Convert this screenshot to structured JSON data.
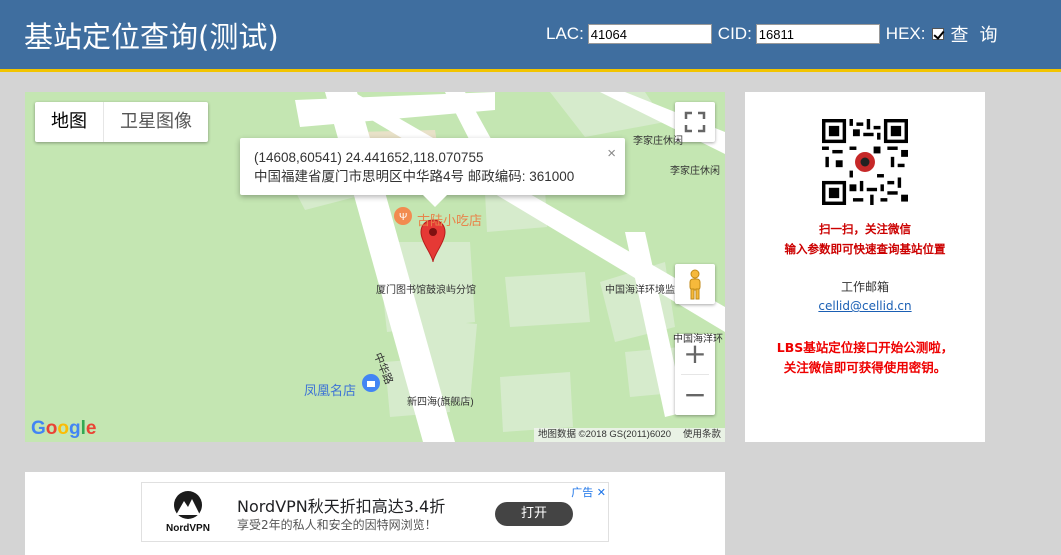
{
  "header": {
    "title": "基站定位查询(测试)",
    "lac_label": "LAC:",
    "lac_value": "41064",
    "cid_label": "CID:",
    "cid_value": "16811",
    "hex_label": "HEX:",
    "hex_checked": true,
    "query_label": "查 询"
  },
  "map": {
    "type_buttons": [
      "地图",
      "卫星图像"
    ],
    "info": {
      "line1": "(14608,60541)  24.441652,118.070755",
      "line2": "中国福建省厦门市思明区中华路4号 邮政编码: 361000",
      "close": "×"
    },
    "labels": {
      "l1": "李家庄休闲",
      "l2": "李家庄休闲",
      "l3": "古陆小吃店",
      "l4": "厦门图书馆鼓浪屿分馆",
      "l5": "中国海洋环境监",
      "l6": "中华路",
      "l7": "凤凰名店",
      "l8": "新四海(旗舰店)",
      "l9": "中国海洋环"
    },
    "zoom_in": "+",
    "zoom_out": "−",
    "attribution": "地图数据 ©2018 GS(2011)6020",
    "terms": "使用条款",
    "google": [
      "G",
      "o",
      "o",
      "g",
      "l",
      "e"
    ]
  },
  "side": {
    "scan_line1": "扫一扫，关注微信",
    "scan_line2": "输入参数即可快速查询基站位置",
    "mail_title": "工作邮箱",
    "mail": "cellid@cellid.cn",
    "notice_line1": "LBS基站定位接口开始公测啦，",
    "notice_line2": "关注微信即可获得使用密钥。"
  },
  "ad": {
    "brand": "NordVPN",
    "headline": "NordVPN秋天折扣高达3.4折",
    "sub": "享受2年的私人和安全的因特网浏览！",
    "button": "打开",
    "adchoice": "广告"
  },
  "colors": {
    "header_bg": "#3f6e9f",
    "header_border": "#f2c400",
    "map_green": "#c4e6b2",
    "notice_red": "#e00000"
  }
}
